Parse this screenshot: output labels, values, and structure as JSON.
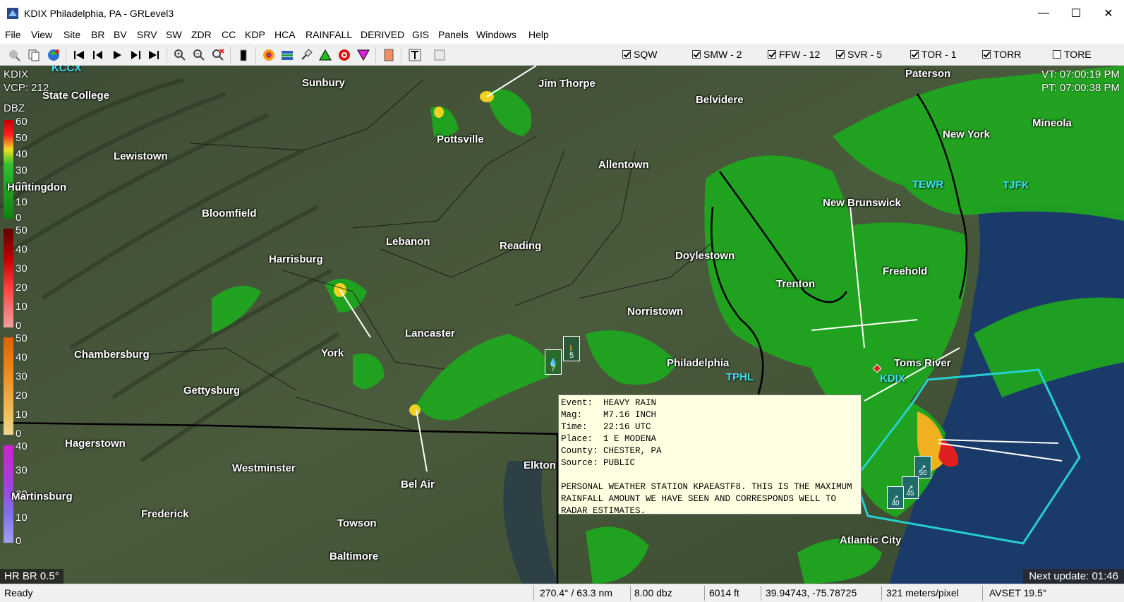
{
  "window": {
    "title": "KDIX Philadelphia, PA - GRLevel3",
    "minimize": "—",
    "maximize": "☐",
    "close": "✕"
  },
  "menu": [
    "File",
    "View",
    "Site",
    "BR",
    "BV",
    "SRV",
    "SW",
    "ZDR",
    "CC",
    "KDP",
    "HCA",
    "RAINFALL",
    "DERIVED",
    "GIS",
    "Panels",
    "Windows",
    "Help"
  ],
  "warnings": [
    {
      "label": "SQW",
      "checked": true
    },
    {
      "label": "SMW - 2",
      "checked": true
    },
    {
      "label": "FFW - 12",
      "checked": true
    },
    {
      "label": "SVR - 5",
      "checked": true
    },
    {
      "label": "TOR - 1",
      "checked": true
    },
    {
      "label": "TORR",
      "checked": true
    },
    {
      "label": "TORE",
      "checked": false
    }
  ],
  "map": {
    "site_id": "KDIX",
    "vcp": "VCP: 212",
    "unit": "DBZ",
    "vt": "VT: 07:00:19 PM",
    "pt": "PT: 07:00:38 PM",
    "product": "HR BR 0.5°",
    "next_update": "Next update: 01:46",
    "scale_labels": [
      [
        "60",
        "50",
        "40",
        "30",
        "20",
        "10",
        "0"
      ],
      [
        "50",
        "40",
        "30",
        "20",
        "10",
        "0"
      ],
      [
        "50",
        "40",
        "30",
        "20",
        "10",
        "0"
      ],
      [
        "40",
        "30",
        "20",
        "10",
        "0"
      ]
    ],
    "cities": [
      "State College",
      "Sunbury",
      "Jim Thorpe",
      "Belvidere",
      "Paterson",
      "Pottsville",
      "Lewistown",
      "Allentown",
      "New York",
      "Mineola",
      "Huntingdon",
      "Bloomfield",
      "New Brunswick",
      "Lebanon",
      "Reading",
      "Harrisburg",
      "Doylestown",
      "Trenton",
      "Freehold",
      "Norristown",
      "Lancaster",
      "Chambersburg",
      "York",
      "Philadelphia",
      "Toms River",
      "Gettysburg",
      "Hagerstown",
      "Westminster",
      "Elkton",
      "Bel Air",
      "Frederick",
      "Towson",
      "Baltimore",
      "Atlantic City",
      "Martinsburg"
    ],
    "sites": [
      "KCCX",
      "TEWR",
      "TJFK",
      "TPHL",
      "KDIX"
    ],
    "markers": [
      "7",
      "5",
      "50",
      "45",
      "40"
    ]
  },
  "popup": {
    "event": "Event:  HEAVY RAIN",
    "mag": "Mag:    M7.16 INCH",
    "time": "Time:   22:16 UTC",
    "place": "Place:  1 E MODENA",
    "county": "County: CHESTER, PA",
    "source": "Source: PUBLIC",
    "remarks": "PERSONAL WEATHER STATION KPAEASTF8. THIS IS THE MAXIMUM RAINFALL AMOUNT WE HAVE SEEN AND CORRESPONDS WELL TO RADAR ESTIMATES."
  },
  "status": {
    "ready": "Ready",
    "azimuth": "270.4° / 63.3 nm",
    "dbz": "8.00 dbz",
    "height": "6014 ft",
    "coords": "39.94743, -75.78725",
    "resolution": "321 meters/pixel",
    "avset": "AVSET 19.5°"
  },
  "colors": {
    "radar_green": "#1ea81e",
    "radar_yellow": "#f0e020",
    "radar_red": "#e02020",
    "warning_cyan": "#26d0d0",
    "ocean": "#1a3a6a"
  }
}
